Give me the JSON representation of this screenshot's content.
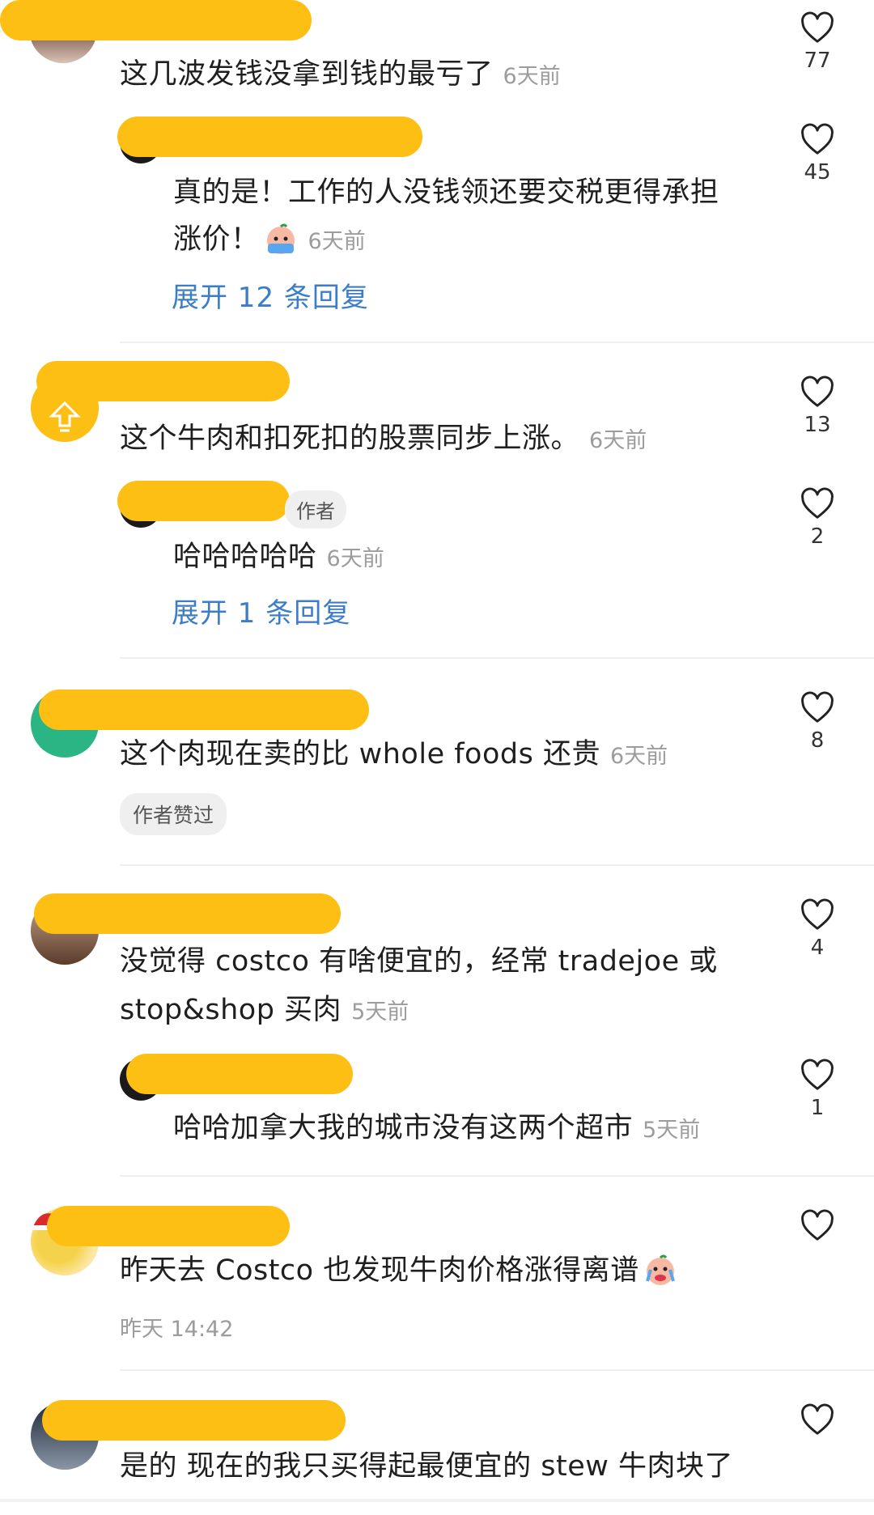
{
  "comments": [
    {
      "text": "这几波发钱没拿到钱的最亏了",
      "time": "6天前",
      "likes": "77",
      "reply": {
        "text_line1": "真的是！工作的人没钱领还要交税更得承担",
        "text_line2": "涨价！",
        "time": "6天前",
        "likes": "45",
        "expand": "展开 12 条回复"
      }
    },
    {
      "text": "这个牛肉和扣死扣的股票同步上涨。",
      "time": "6天前",
      "likes": "13",
      "reply": {
        "author_tag": "作者",
        "text": "哈哈哈哈哈",
        "time": "6天前",
        "likes": "2",
        "expand": "展开 1 条回复"
      }
    },
    {
      "text": "这个肉现在卖的比 whole foods 还贵",
      "time": "6天前",
      "likes": "8",
      "tag": "作者赞过"
    },
    {
      "text_line1": "没觉得 costco 有啥便宜的，经常 tradejoe 或",
      "text_line2": "stop&shop 买肉",
      "time": "5天前",
      "likes": "4",
      "reply": {
        "text": "哈哈加拿大我的城市没有这两个超市",
        "time": "5天前",
        "likes": "1"
      }
    },
    {
      "text": "昨天去 Costco 也发现牛肉价格涨得离谱",
      "time": "昨天 14:42"
    },
    {
      "text": "是的 现在的我只买得起最便宜的 stew 牛肉块了"
    }
  ],
  "icons": {
    "like": "heart-outline-icon",
    "emoji": "crying-face-icon"
  },
  "colors": {
    "redaction": "#fdbf14",
    "link": "#3b7dc9",
    "meta": "#9c9c9c"
  }
}
